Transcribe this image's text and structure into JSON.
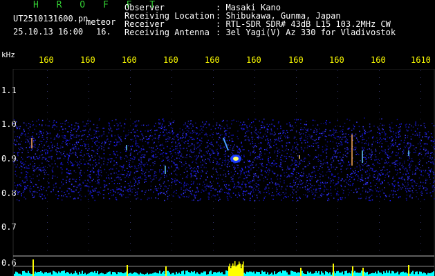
{
  "header": {
    "title": "H R O F F T",
    "filename": "UT2510131600.pn",
    "tag": "meteor",
    "datetime": "25.10.13 16:00",
    "extra": "16."
  },
  "info": {
    "labels": [
      "Observer",
      "Receiving Location",
      "Receiver",
      "Receiving Antenna"
    ],
    "values": [
      ": Masaki Kano",
      ": Shibukawa, Gunma, Japan",
      ": RTL-SDR SDR# 43dB L15 103.2MHz CW",
      ": 3el Yagi(V) Az 330 for Vladivostok"
    ]
  },
  "axis": {
    "ylabel": "kHz",
    "xticks": [
      "160",
      "160",
      "160",
      "160",
      "160",
      "160",
      "160",
      "160",
      "160",
      "1610"
    ],
    "yticks": [
      "1.1",
      "1.0",
      "0.9",
      "0.8",
      "0.7",
      "0.6"
    ]
  },
  "colors": {
    "background": "#000000",
    "title": "#33cc33",
    "xtick": "#ffff00",
    "noise": "#1a1aff",
    "trace": "#00ffff",
    "spike": "#ffff00"
  }
}
